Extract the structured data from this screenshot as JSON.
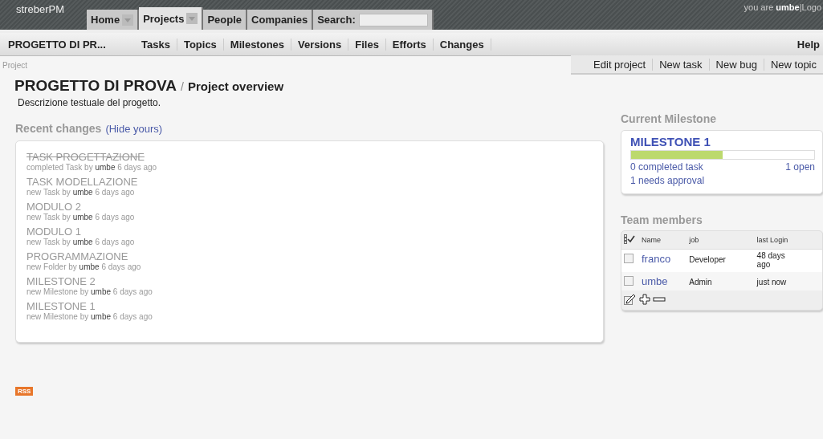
{
  "app": {
    "logo": "streberPM",
    "user_text": "you are **umbe**|Logo"
  },
  "main_tabs": [
    {
      "label": "Home",
      "selected": false,
      "dropdown": true
    },
    {
      "label": "Projects",
      "selected": true,
      "dropdown": true
    },
    {
      "label": "People",
      "selected": false,
      "dropdown": false
    },
    {
      "label": "Companies",
      "selected": false,
      "dropdown": false
    }
  ],
  "search": {
    "label": "Search:"
  },
  "sub_nav": {
    "crumb": "PROGETTO DI PR...",
    "items": [
      "Tasks",
      "Topics",
      "Milestones",
      "Versions",
      "Files",
      "Efforts",
      "Changes"
    ],
    "help": "Help"
  },
  "breadcrumb": "Project",
  "actions": [
    "Edit project",
    "New task",
    "New bug",
    "New topic"
  ],
  "title": {
    "main": "PROGETTO DI PROVA",
    "separator": "/",
    "sub": "Project overview"
  },
  "description": "Descrizione testuale del progetto.",
  "recent_changes": {
    "heading": "Recent changes",
    "link": "(Hide yours)",
    "items": [
      {
        "title": "TASK PROGETTAZIONE",
        "done": true,
        "meta": "completed Task by **umbe** 6 days ago"
      },
      {
        "title": "TASK MODELLAZIONE",
        "done": false,
        "meta": "new Task by **umbe** 6 days ago"
      },
      {
        "title": "MODULO 2",
        "done": false,
        "meta": "new Task by **umbe** 6 days ago"
      },
      {
        "title": "MODULO 1",
        "done": false,
        "meta": "new Task by **umbe** 6 days ago"
      },
      {
        "title": "PROGRAMMAZIONE",
        "done": false,
        "meta": "new Folder by **umbe** 6 days ago"
      },
      {
        "title": "MILESTONE 2",
        "done": false,
        "meta": "new Milestone by **umbe** 6 days ago"
      },
      {
        "title": "MILESTONE 1",
        "done": false,
        "meta": "new Milestone by **umbe** 6 days ago"
      }
    ]
  },
  "milestone": {
    "heading": "Current Milestone",
    "name": "MILESTONE 1",
    "level": 0.5,
    "completed": "0 completed task",
    "open": "1 open",
    "approval": "1 needs approval"
  },
  "team": {
    "heading": "Team members",
    "columns": [
      "Name",
      "job",
      "last Login"
    ],
    "rows": [
      {
        "name": "franco",
        "job": "Developer",
        "last_login": "48 days ago",
        "checked": false
      },
      {
        "name": "umbe",
        "job": "Admin",
        "last_login": "just now",
        "checked": false
      }
    ]
  },
  "rss": "RSS"
}
